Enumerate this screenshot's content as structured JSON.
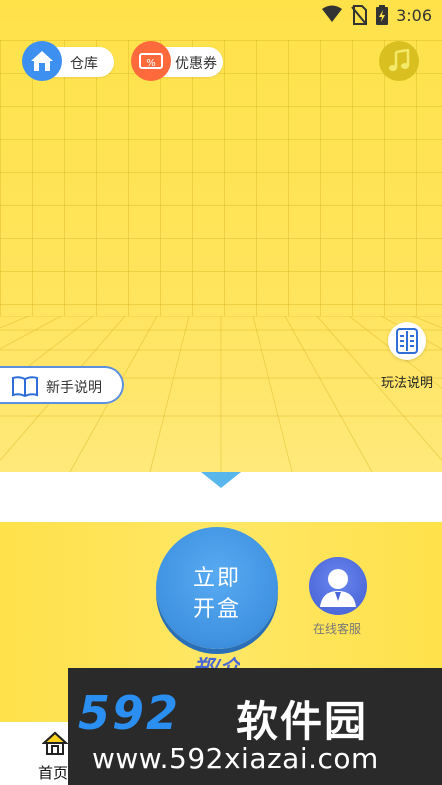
{
  "status_bar": {
    "time": "3:06",
    "icons": [
      "wifi-icon",
      "no-sim-icon",
      "battery-charging-icon"
    ]
  },
  "top_bar": {
    "warehouse_label": "仓库",
    "coupon_label": "优惠券",
    "coupon_badge": "%",
    "music_icon": "music-note-icon"
  },
  "side_buttons": {
    "guide_label": "新手说明",
    "rules_label": "玩法说明"
  },
  "main": {
    "open_box_line1": "立即",
    "open_box_line2": "开盒",
    "customer_service_label": "在线客服",
    "truncated_text": "郑/介"
  },
  "bottom_nav": {
    "home_label": "首页"
  },
  "watermark": {
    "logo_number": "592",
    "logo_text": "软件园",
    "url": "www.592xiazai.com"
  },
  "colors": {
    "stage_yellow": "#ffe24a",
    "accent_blue": "#3f92e0",
    "coupon_orange": "#ff6a3d",
    "home_blue": "#3d8ff0"
  }
}
